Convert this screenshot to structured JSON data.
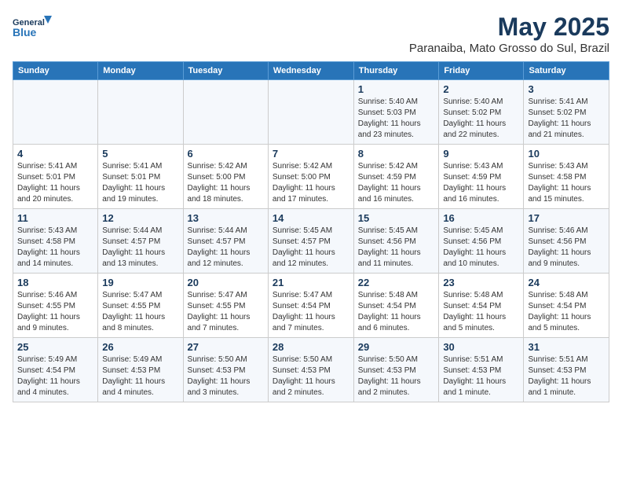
{
  "header": {
    "logo_line1": "General",
    "logo_line2": "Blue",
    "month": "May 2025",
    "location": "Paranaiba, Mato Grosso do Sul, Brazil"
  },
  "days": [
    "Sunday",
    "Monday",
    "Tuesday",
    "Wednesday",
    "Thursday",
    "Friday",
    "Saturday"
  ],
  "weeks": [
    [
      {
        "date": "",
        "content": ""
      },
      {
        "date": "",
        "content": ""
      },
      {
        "date": "",
        "content": ""
      },
      {
        "date": "",
        "content": ""
      },
      {
        "date": "1",
        "content": "Sunrise: 5:40 AM\nSunset: 5:03 PM\nDaylight: 11 hours and 23 minutes."
      },
      {
        "date": "2",
        "content": "Sunrise: 5:40 AM\nSunset: 5:02 PM\nDaylight: 11 hours and 22 minutes."
      },
      {
        "date": "3",
        "content": "Sunrise: 5:41 AM\nSunset: 5:02 PM\nDaylight: 11 hours and 21 minutes."
      }
    ],
    [
      {
        "date": "4",
        "content": "Sunrise: 5:41 AM\nSunset: 5:01 PM\nDaylight: 11 hours and 20 minutes."
      },
      {
        "date": "5",
        "content": "Sunrise: 5:41 AM\nSunset: 5:01 PM\nDaylight: 11 hours and 19 minutes."
      },
      {
        "date": "6",
        "content": "Sunrise: 5:42 AM\nSunset: 5:00 PM\nDaylight: 11 hours and 18 minutes."
      },
      {
        "date": "7",
        "content": "Sunrise: 5:42 AM\nSunset: 5:00 PM\nDaylight: 11 hours and 17 minutes."
      },
      {
        "date": "8",
        "content": "Sunrise: 5:42 AM\nSunset: 4:59 PM\nDaylight: 11 hours and 16 minutes."
      },
      {
        "date": "9",
        "content": "Sunrise: 5:43 AM\nSunset: 4:59 PM\nDaylight: 11 hours and 16 minutes."
      },
      {
        "date": "10",
        "content": "Sunrise: 5:43 AM\nSunset: 4:58 PM\nDaylight: 11 hours and 15 minutes."
      }
    ],
    [
      {
        "date": "11",
        "content": "Sunrise: 5:43 AM\nSunset: 4:58 PM\nDaylight: 11 hours and 14 minutes."
      },
      {
        "date": "12",
        "content": "Sunrise: 5:44 AM\nSunset: 4:57 PM\nDaylight: 11 hours and 13 minutes."
      },
      {
        "date": "13",
        "content": "Sunrise: 5:44 AM\nSunset: 4:57 PM\nDaylight: 11 hours and 12 minutes."
      },
      {
        "date": "14",
        "content": "Sunrise: 5:45 AM\nSunset: 4:57 PM\nDaylight: 11 hours and 12 minutes."
      },
      {
        "date": "15",
        "content": "Sunrise: 5:45 AM\nSunset: 4:56 PM\nDaylight: 11 hours and 11 minutes."
      },
      {
        "date": "16",
        "content": "Sunrise: 5:45 AM\nSunset: 4:56 PM\nDaylight: 11 hours and 10 minutes."
      },
      {
        "date": "17",
        "content": "Sunrise: 5:46 AM\nSunset: 4:56 PM\nDaylight: 11 hours and 9 minutes."
      }
    ],
    [
      {
        "date": "18",
        "content": "Sunrise: 5:46 AM\nSunset: 4:55 PM\nDaylight: 11 hours and 9 minutes."
      },
      {
        "date": "19",
        "content": "Sunrise: 5:47 AM\nSunset: 4:55 PM\nDaylight: 11 hours and 8 minutes."
      },
      {
        "date": "20",
        "content": "Sunrise: 5:47 AM\nSunset: 4:55 PM\nDaylight: 11 hours and 7 minutes."
      },
      {
        "date": "21",
        "content": "Sunrise: 5:47 AM\nSunset: 4:54 PM\nDaylight: 11 hours and 7 minutes."
      },
      {
        "date": "22",
        "content": "Sunrise: 5:48 AM\nSunset: 4:54 PM\nDaylight: 11 hours and 6 minutes."
      },
      {
        "date": "23",
        "content": "Sunrise: 5:48 AM\nSunset: 4:54 PM\nDaylight: 11 hours and 5 minutes."
      },
      {
        "date": "24",
        "content": "Sunrise: 5:48 AM\nSunset: 4:54 PM\nDaylight: 11 hours and 5 minutes."
      }
    ],
    [
      {
        "date": "25",
        "content": "Sunrise: 5:49 AM\nSunset: 4:54 PM\nDaylight: 11 hours and 4 minutes."
      },
      {
        "date": "26",
        "content": "Sunrise: 5:49 AM\nSunset: 4:53 PM\nDaylight: 11 hours and 4 minutes."
      },
      {
        "date": "27",
        "content": "Sunrise: 5:50 AM\nSunset: 4:53 PM\nDaylight: 11 hours and 3 minutes."
      },
      {
        "date": "28",
        "content": "Sunrise: 5:50 AM\nSunset: 4:53 PM\nDaylight: 11 hours and 2 minutes."
      },
      {
        "date": "29",
        "content": "Sunrise: 5:50 AM\nSunset: 4:53 PM\nDaylight: 11 hours and 2 minutes."
      },
      {
        "date": "30",
        "content": "Sunrise: 5:51 AM\nSunset: 4:53 PM\nDaylight: 11 hours and 1 minute."
      },
      {
        "date": "31",
        "content": "Sunrise: 5:51 AM\nSunset: 4:53 PM\nDaylight: 11 hours and 1 minute."
      }
    ]
  ]
}
